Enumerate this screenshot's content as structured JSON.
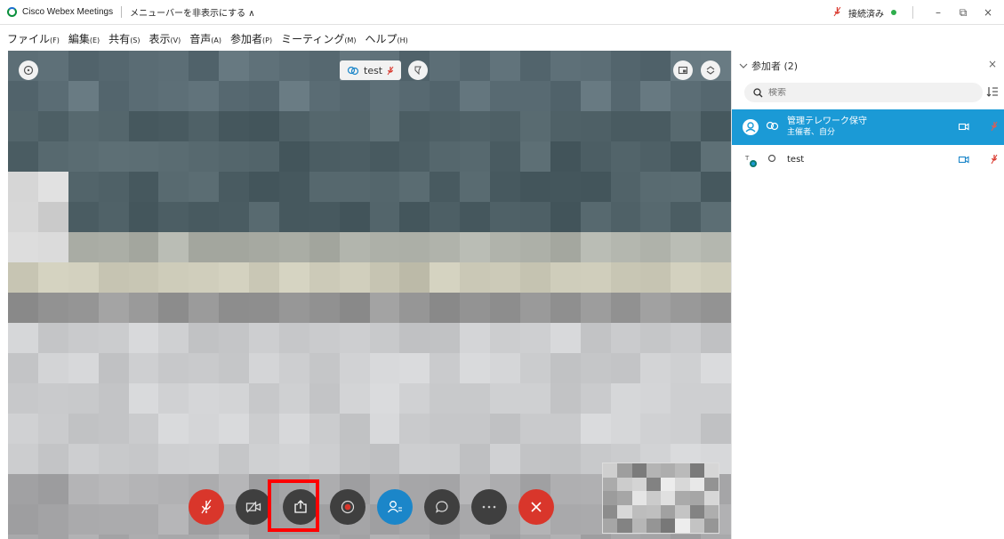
{
  "titlebar": {
    "app_title": "Cisco Webex Meetings",
    "hide_menu": "メニューバーを非表示にする ∧",
    "connection_status": "接続済み",
    "minimize": "–",
    "restore": "⧉",
    "close": "×"
  },
  "menubar": {
    "items": [
      {
        "label": "ファイル",
        "key": "(F)"
      },
      {
        "label": "編集",
        "key": "(E)"
      },
      {
        "label": "共有",
        "key": "(S)"
      },
      {
        "label": "表示",
        "key": "(V)"
      },
      {
        "label": "音声",
        "key": "(A)"
      },
      {
        "label": "参加者",
        "key": "(P)"
      },
      {
        "label": "ミーティング",
        "key": "(M)"
      },
      {
        "label": "ヘルプ",
        "key": "(H)"
      }
    ]
  },
  "video": {
    "active_speaker": "test"
  },
  "panel": {
    "title": "参加者 (2)",
    "close": "×",
    "search_placeholder": "検索",
    "participants": [
      {
        "name": "管理テレワーク保守",
        "role": "主催者、自分"
      },
      {
        "name": "test",
        "role": ""
      }
    ]
  },
  "colors": {
    "accent_blue": "#1b9ad6",
    "mute_red": "#d9362b",
    "control_dark": "#3f3f3f",
    "highlight_red": "#ff0000"
  }
}
